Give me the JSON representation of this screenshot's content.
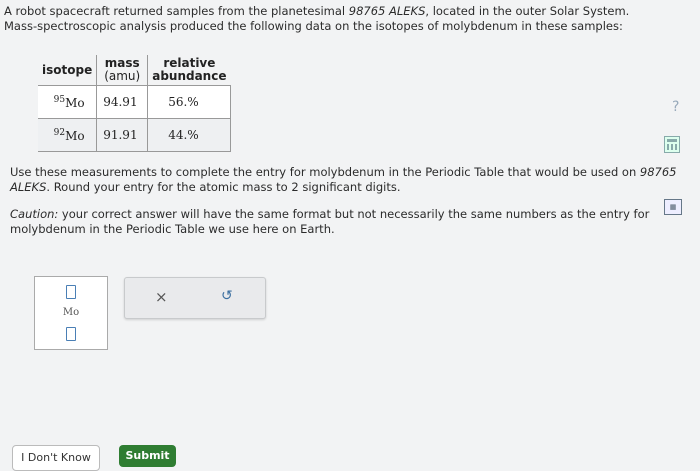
{
  "question": {
    "line1_a": "A robot spacecraft returned samples from the planetesimal ",
    "planetesimal_name": "98765 ALEKS",
    "line1_b": ", located in the outer Solar System. Mass-spectroscopic analysis produced the following data on the isotopes of molybdenum in these samples:"
  },
  "table": {
    "headers": {
      "isotope": "isotope",
      "mass_top": "mass",
      "mass_unit": "(amu)",
      "abundance_top": "relative",
      "abundance_bottom": "abundance"
    },
    "rows": [
      {
        "mass_number": "95",
        "symbol": "Mo",
        "mass": "94.91",
        "abundance": "56.%"
      },
      {
        "mass_number": "92",
        "symbol": "Mo",
        "mass": "91.91",
        "abundance": "44.%"
      }
    ]
  },
  "instructions": {
    "a": "Use these measurements to complete the entry for molybdenum in the Periodic Table that would be used on ",
    "name": "98765 ALEKS",
    "b": ". Round your entry for the atomic mass to 2 significant digits."
  },
  "caution": {
    "label": "Caution:",
    "text": " your correct answer will have the same format but not necessarily the same numbers as the entry for molybdenum in the Periodic Table we use here on Earth."
  },
  "element_entry": {
    "symbol": "Mo"
  },
  "tools": {
    "clear_icon": "×",
    "undo_icon": "↺"
  },
  "help_icon": "?",
  "buttons": {
    "dont_know": "I Don't Know",
    "submit": "Submit"
  }
}
